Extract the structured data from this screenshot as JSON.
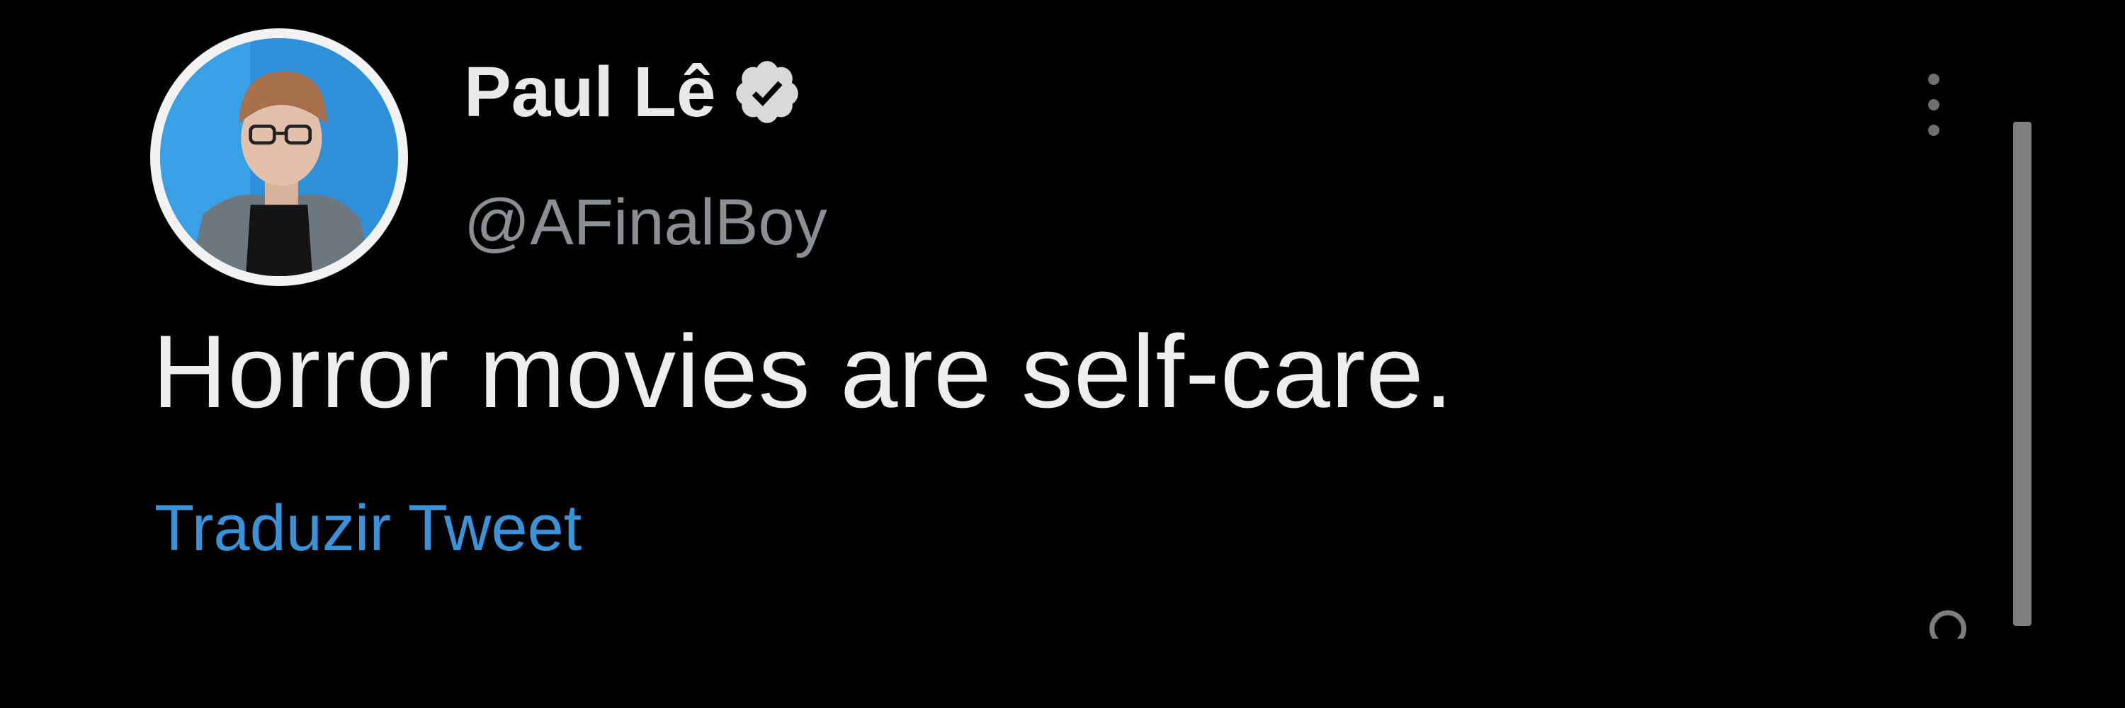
{
  "tweet": {
    "author": {
      "display_name": "Paul Lê",
      "handle": "@AFinalBoy",
      "verified": true,
      "avatar_icon": "profile-photo"
    },
    "text": "Horror movies are self-care.",
    "translate_label": "Traduzir Tweet",
    "more_icon": "vertical-ellipsis-icon"
  },
  "colors": {
    "background": "#000000",
    "text_primary": "#eeeeee",
    "text_secondary": "#8b8f93",
    "link": "#3a93d8",
    "avatar_bg": "#2f8fd8"
  }
}
